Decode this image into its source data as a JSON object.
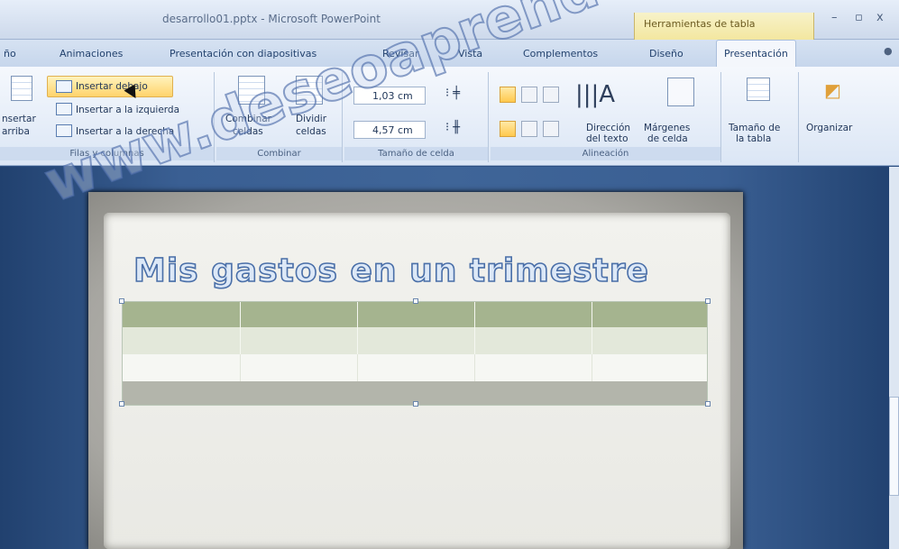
{
  "window": {
    "title": "desarrollo01.pptx - Microsoft PowerPoint",
    "context_title": "Herramientas de tabla",
    "minimize": "–",
    "restore": "▫",
    "close": "x"
  },
  "tabs": [
    "ño",
    "Animaciones",
    "Presentación con diapositivas",
    "Revisar",
    "Vista",
    "Complementos",
    "Diseño",
    "Presentación"
  ],
  "ribbon": {
    "filas": {
      "insertar_debajo": "Insertar debajo",
      "insertar_izquierda": "Insertar a la izquierda",
      "insertar_derecha": "Insertar a la derecha",
      "insertar_arriba_1": "nsertar",
      "insertar_arriba_2": "arriba",
      "label": "Filas y columnas"
    },
    "combinar": {
      "combinar_1": "Combinar",
      "combinar_2": "celdas",
      "dividir_1": "Dividir",
      "dividir_2": "celdas",
      "label": "Combinar"
    },
    "tamano": {
      "alto": "1,03 cm",
      "ancho": "4,57 cm",
      "label": "Tamaño de celda"
    },
    "alineacion": {
      "direccion_1": "Dirección",
      "direccion_2": "del texto",
      "margenes_1": "Márgenes",
      "margenes_2": "de celda",
      "label": "Alineación"
    },
    "tabla": {
      "tamano_1": "Tamaño de",
      "tamano_2": "la tabla"
    },
    "organizar": {
      "label": "Organizar"
    }
  },
  "slide": {
    "title": "Mis gastos en un trimestre"
  },
  "watermark": "www.deseoaprender.com",
  "colors": {
    "row_dark": "#a5b48f",
    "row_mid": "#e3e8da",
    "row_light": "#f6f7f3",
    "context_tab": "#f3e7a0"
  }
}
